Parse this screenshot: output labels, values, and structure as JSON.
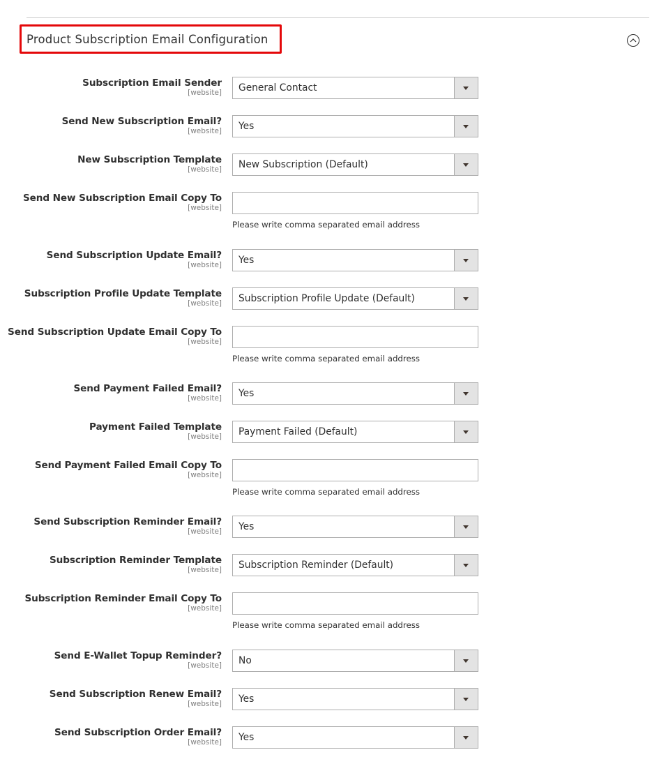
{
  "section": {
    "title": "Product Subscription Email Configuration",
    "collapse_icon": "chevron-up-circle-icon",
    "highlight_color": "#e4080a"
  },
  "fields": [
    {
      "label": "Subscription Email Sender",
      "scope": "[website]",
      "type": "select",
      "value": "General Contact"
    },
    {
      "label": "Send New Subscription Email?",
      "scope": "[website]",
      "type": "select",
      "value": "Yes"
    },
    {
      "label": "New Subscription Template",
      "scope": "[website]",
      "type": "select",
      "value": "New Subscription (Default)"
    },
    {
      "label": "Send New Subscription Email Copy To",
      "scope": "[website]",
      "type": "text",
      "value": "",
      "note": "Please write comma separated email address"
    },
    {
      "label": "Send Subscription Update Email?",
      "scope": "[website]",
      "type": "select",
      "value": "Yes"
    },
    {
      "label": "Subscription Profile Update Template",
      "scope": "[website]",
      "type": "select",
      "value": "Subscription Profile Update (Default)"
    },
    {
      "label": "Send Subscription Update Email Copy To",
      "scope": "[website]",
      "type": "text",
      "value": "",
      "note": "Please write comma separated email address"
    },
    {
      "label": "Send Payment Failed Email?",
      "scope": "[website]",
      "type": "select",
      "value": "Yes"
    },
    {
      "label": "Payment Failed Template",
      "scope": "[website]",
      "type": "select",
      "value": "Payment Failed (Default)"
    },
    {
      "label": "Send Payment Failed Email Copy To",
      "scope": "[website]",
      "type": "text",
      "value": "",
      "note": "Please write comma separated email address"
    },
    {
      "label": "Send Subscription Reminder Email?",
      "scope": "[website]",
      "type": "select",
      "value": "Yes"
    },
    {
      "label": "Subscription Reminder Template",
      "scope": "[website]",
      "type": "select",
      "value": "Subscription Reminder (Default)"
    },
    {
      "label": "Subscription Reminder Email Copy To",
      "scope": "[website]",
      "type": "text",
      "value": "",
      "note": "Please write comma separated email address"
    },
    {
      "label": "Send E-Wallet Topup Reminder?",
      "scope": "[website]",
      "type": "select",
      "value": "No"
    },
    {
      "label": "Send Subscription Renew Email?",
      "scope": "[website]",
      "type": "select",
      "value": "Yes"
    },
    {
      "label": "Send Subscription Order Email?",
      "scope": "[website]",
      "type": "select",
      "value": "Yes"
    }
  ]
}
